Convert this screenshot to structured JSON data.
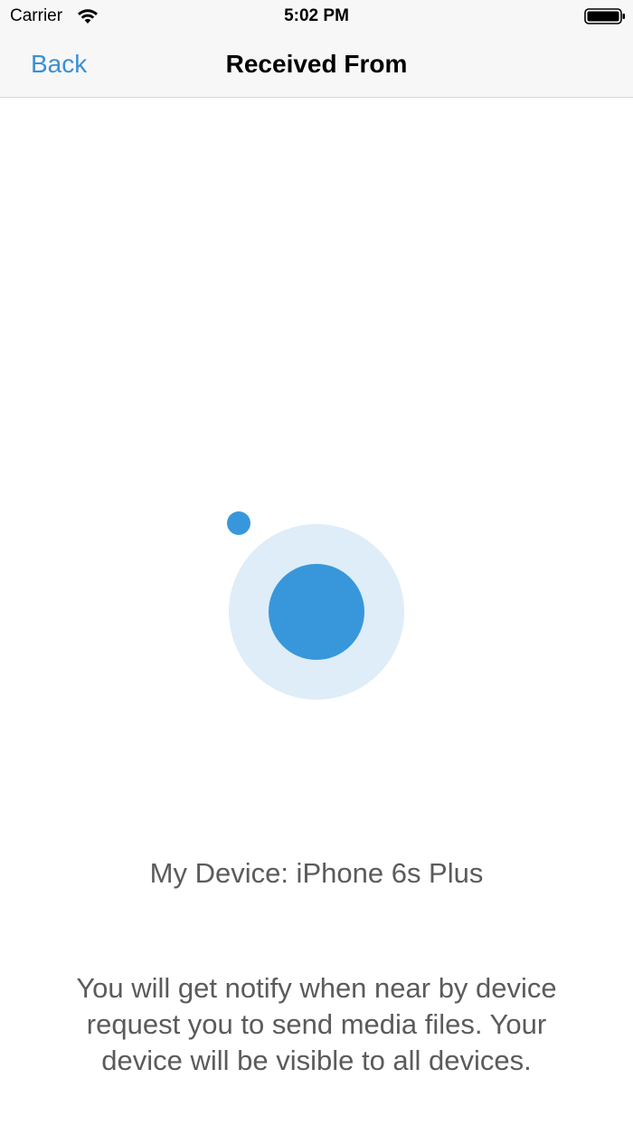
{
  "status_bar": {
    "carrier": "Carrier",
    "time": "5:02 PM",
    "wifi_icon": "wifi-icon",
    "battery_icon": "battery-icon"
  },
  "nav": {
    "back_label": "Back",
    "title": "Received From"
  },
  "radar": {
    "icon": "radar-icon",
    "outer_color": "#deedf8",
    "inner_color": "#3897db",
    "satellite_color": "#3897db"
  },
  "content": {
    "device_label": "My Device: iPhone 6s Plus",
    "info_line_1": "You will get notify when near by device",
    "info_line_2": "request you to send media files. Your",
    "info_line_3": "device will be visible to all devices."
  },
  "colors": {
    "accent": "#3a8fd6",
    "text_secondary": "#5b5b5b",
    "nav_background": "#f7f7f7"
  }
}
